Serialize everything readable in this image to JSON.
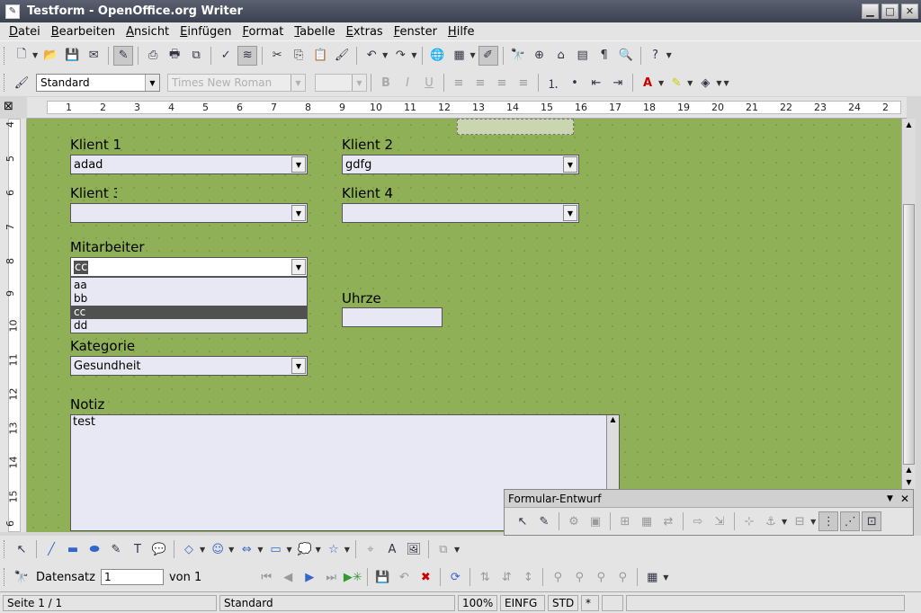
{
  "window": {
    "title": "Testform - OpenOffice.org Writer"
  },
  "menu": [
    "Datei",
    "Bearbeiten",
    "Ansicht",
    "Einfügen",
    "Format",
    "Tabelle",
    "Extras",
    "Fenster",
    "Hilfe"
  ],
  "formatting": {
    "style": "Standard",
    "font": "Times New Roman",
    "size": ""
  },
  "ruler": {
    "h_ticks": [
      "1",
      "2",
      "3",
      "4",
      "5",
      "6",
      "7",
      "8",
      "9",
      "10",
      "11",
      "12",
      "13",
      "14",
      "15",
      "16",
      "17",
      "18",
      "19",
      "20",
      "21",
      "22",
      "23",
      "24",
      "2"
    ],
    "v_ticks": [
      "4",
      "5",
      "6",
      "7",
      "8",
      "9",
      "10",
      "11",
      "12",
      "13",
      "14",
      "15",
      "6"
    ]
  },
  "form": {
    "klient1": {
      "label": "Klient 1",
      "value": "adad"
    },
    "klient2": {
      "label": "Klient 2",
      "value": "gdfg"
    },
    "klient3": {
      "label": "Klient 3",
      "value": ""
    },
    "klient4": {
      "label": "Klient 4",
      "value": ""
    },
    "mitarbeiter": {
      "label": "Mitarbeiter",
      "value": "cc",
      "options": [
        "aa",
        "bb",
        "cc",
        "dd"
      ],
      "selected": "cc"
    },
    "uhrzeit": {
      "label": "Uhrze",
      "value": ""
    },
    "kategorie": {
      "label": "Kategorie",
      "value": "Gesundheit"
    },
    "notiz": {
      "label": "Notiz",
      "value": "test"
    }
  },
  "form_design_toolbar": {
    "title": "Formular-Entwurf"
  },
  "navigation": {
    "record_label": "Datensatz",
    "record_value": "1",
    "of_label": "von 1"
  },
  "status": {
    "page": "Seite 1 / 1",
    "style": "Standard",
    "zoom": "100%",
    "insert_mode": "EINFG",
    "selection_mode": "STD",
    "modified": "*"
  }
}
